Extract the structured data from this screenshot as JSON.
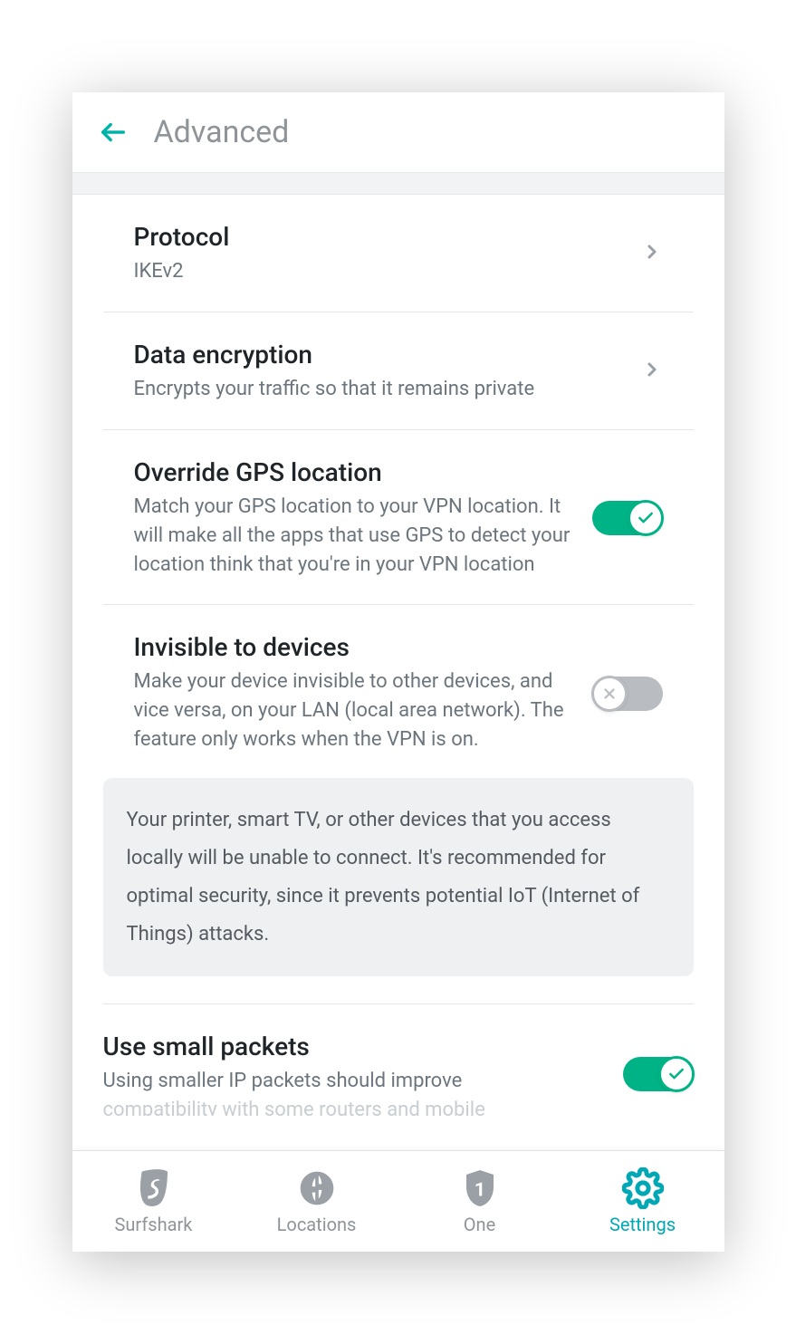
{
  "header": {
    "title": "Advanced"
  },
  "sections": {
    "protocol": {
      "title": "Protocol",
      "value": "IKEv2"
    },
    "encryption": {
      "title": "Data encryption",
      "desc": "Encrypts your traffic so that it remains private"
    },
    "gps": {
      "title": "Override GPS location",
      "desc": "Match your GPS location to your VPN location. It will make all the apps that use GPS to detect your location think that you're in your VPN location",
      "on": true
    },
    "invisible": {
      "title": "Invisible to devices",
      "desc": "Make your device invisible to other devices, and vice versa, on your LAN (local area network). The feature only works when the VPN is on.",
      "info": "Your printer, smart TV, or other devices that you access locally will be unable to connect. It's recommended for optimal security, since it prevents potential IoT (Internet of Things) attacks.",
      "on": false
    },
    "smallpackets": {
      "title": "Use small packets",
      "desc": "Using smaller IP packets should improve",
      "desc_cut": "compatibility with some routers and mobile",
      "on": true
    }
  },
  "nav": {
    "surfshark": "Surfshark",
    "locations": "Locations",
    "one": "One",
    "settings": "Settings",
    "active": "settings"
  }
}
